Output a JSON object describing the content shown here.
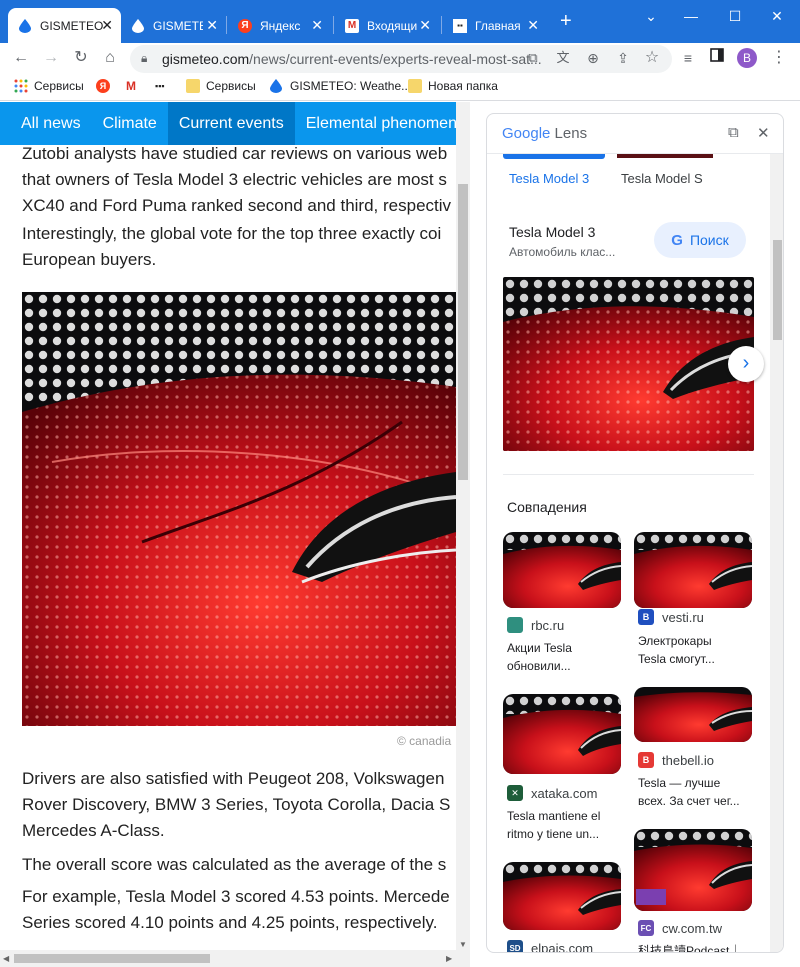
{
  "browser": {
    "tabs": [
      {
        "label": "GISMETEO",
        "icon": "gismeteo-drop-icon",
        "active": true
      },
      {
        "label": "GISMETEO",
        "icon": "gismeteo-drop-icon",
        "active": false
      },
      {
        "label": "Яндекс",
        "icon": "yandex-icon",
        "active": false
      },
      {
        "label": "Входящие",
        "icon": "gmail-icon",
        "active": false
      },
      {
        "label": "Главная",
        "icon": "gismeteo-news-icon",
        "active": false
      }
    ],
    "new_tab": "+",
    "url_domain": "gismeteo.com",
    "url_path": "/news/current-events/experts-reveal-most-sat...",
    "profile_initial": "B",
    "bookmarks": [
      {
        "label": "Сервисы",
        "icon": "apps-grid-icon"
      },
      {
        "label": "",
        "icon": "yandex-icon"
      },
      {
        "label": "",
        "icon": "gmail-icon"
      },
      {
        "label": "",
        "icon": "news-icon"
      },
      {
        "label": "Сервисы",
        "icon": "folder-icon"
      },
      {
        "label": "GISMETEO: Weathe...",
        "icon": "gismeteo-drop-icon"
      },
      {
        "label": "Новая папка",
        "icon": "folder-icon"
      }
    ]
  },
  "site": {
    "nav": [
      {
        "label": "All news",
        "active": false
      },
      {
        "label": "Climate",
        "active": false
      },
      {
        "label": "Current events",
        "active": true
      },
      {
        "label": "Elemental phenomena",
        "active": false
      }
    ],
    "paragraphs": [
      [
        "Zutobi analysts have studied car reviews on various web",
        "that owners of Tesla Model 3 electric vehicles are most s",
        "XC40 and Ford Puma ranked second and third, respectiv"
      ],
      [
        "Interestingly, the global vote for the top three exactly coi",
        "European buyers."
      ],
      [
        "Drivers are also satisfied with Peugeot 208, Volkswagen",
        "Rover Discovery, BMW 3 Series, Toyota Corolla, Dacia S",
        "Mercedes A-Class."
      ],
      [
        "The overall score was calculated as the average of the s"
      ],
      [
        "For example, Tesla Model 3 scored 4.53 points. Mercede",
        "Series scored 4.10 points and 4.25 points, respectively."
      ]
    ],
    "photo_credit": "© canadia"
  },
  "lens": {
    "logo": {
      "google": "Google",
      "lens": "Lens"
    },
    "chips": [
      {
        "label": "Tesla Model 3",
        "selected": true
      },
      {
        "label": "Tesla Model S",
        "selected": false
      }
    ],
    "entity_title": "Tesla Model 3",
    "entity_subtitle": "Автомобиль клас...",
    "search_button": "Поиск",
    "matches_title": "Совпадения",
    "matches": [
      {
        "source": "rbc.ru",
        "favicon_color": "#2f8f7f",
        "favicon_text": "",
        "title": [
          "Акции Tesla",
          "обновили..."
        ]
      },
      {
        "source": "vesti.ru",
        "favicon_color": "#1f4fbf",
        "favicon_text": "B",
        "title": [
          "Электрокары",
          "Tesla смогут..."
        ]
      },
      {
        "source": "xataka.com",
        "favicon_color": "#1e5d3a",
        "favicon_text": "✕",
        "title": [
          "Tesla mantiene el",
          "ritmo y tiene un..."
        ]
      },
      {
        "source": "thebell.io",
        "favicon_color": "#e53935",
        "favicon_text": "B",
        "title": [
          "Tesla — лучше",
          "всех. За счет чег..."
        ]
      },
      {
        "source": "elpais.com",
        "favicon_color": "#1e4f8a",
        "favicon_text": "SD",
        "title": []
      },
      {
        "source": "cw.com.tw",
        "favicon_color": "#6b4fb3",
        "favicon_text": "FC",
        "title": [
          "科技島讀Podcast｜"
        ]
      }
    ]
  }
}
